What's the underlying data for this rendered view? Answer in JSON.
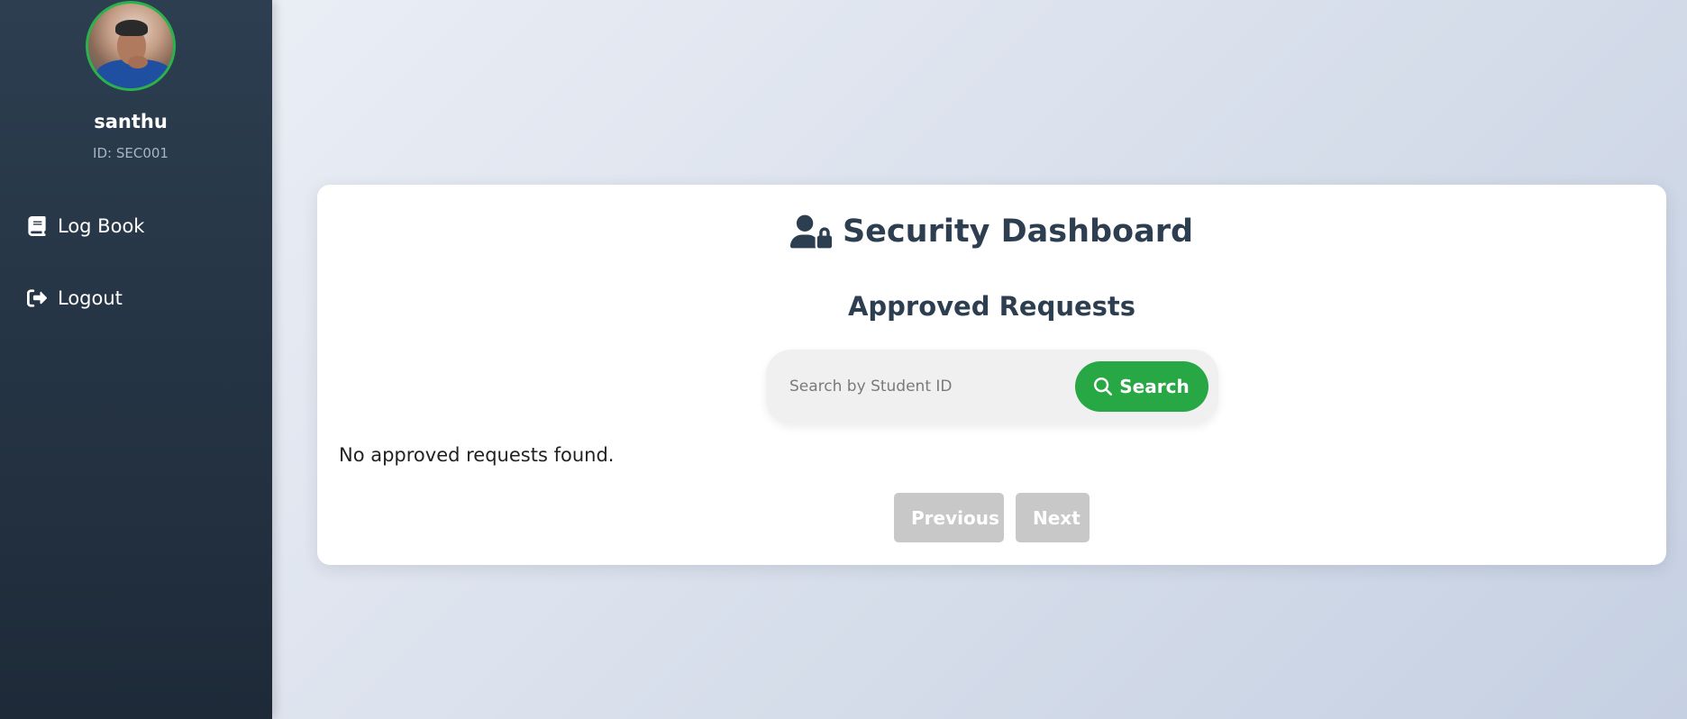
{
  "sidebar": {
    "user": {
      "name": "santhu",
      "id_label": "ID: SEC001"
    },
    "items": [
      {
        "label": "Log Book",
        "icon": "book-icon"
      },
      {
        "label": "Logout",
        "icon": "logout-icon"
      }
    ]
  },
  "main": {
    "title": "Security Dashboard",
    "title_icon": "user-lock-icon",
    "subtitle": "Approved Requests",
    "search": {
      "placeholder": "Search by Student ID",
      "value": "",
      "button_label": "Search",
      "button_icon": "search-icon"
    },
    "empty_message": "No approved requests found.",
    "pagination": {
      "previous_label": "Previous",
      "next_label": "Next"
    }
  },
  "colors": {
    "sidebar": "#2c3e50",
    "accent_green": "#28a745",
    "heading": "#2c3e50",
    "disabled_button": "#c8c8c8"
  }
}
